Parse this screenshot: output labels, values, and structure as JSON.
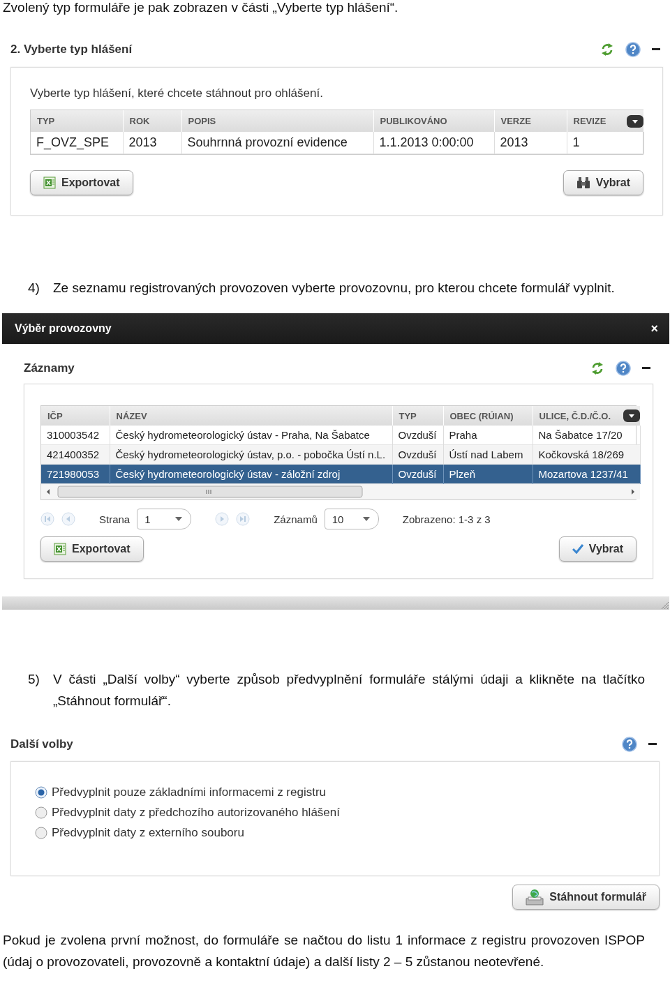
{
  "intro": "Zvolený typ formuláře je pak zobrazen v části „Vyberte typ hlášení“.",
  "report_type_panel": {
    "title": "2. Vyberte typ hlášení",
    "description": "Vyberte typ hlášení, které chcete stáhnout pro ohlášení.",
    "table": {
      "columns": [
        "TYP",
        "ROK",
        "POPIS",
        "PUBLIKOVÁNO",
        "VERZE",
        "REVIZE"
      ],
      "rows": [
        {
          "cells": [
            "F_OVZ_SPE",
            "2013",
            "Souhrnná provozní evidence",
            "1.1.2013 0:00:00",
            "2013",
            "1"
          ],
          "selected": false
        }
      ]
    },
    "buttons": [
      {
        "label": "Exportovat",
        "kind": "export"
      },
      {
        "label": "Vybrat",
        "kind": "pick"
      }
    ]
  },
  "step_4": {
    "number": "4)",
    "text": "Ze seznamu registrovaných provozoven vyberte provozovnu, pro kterou chcete formulář vyplnit."
  },
  "dialog": {
    "title": "Výběr provozovny",
    "close": "×",
    "panel": {
      "title": "Záznamy",
      "table": {
        "columns": [
          "IČP",
          "NÁZEV",
          "TYP",
          "OBEC (RÚIAN)",
          "ULICE, Č.D./Č.O."
        ],
        "rows": [
          {
            "cells": [
              "310003542",
              "Český hydrometeorologický ústav - Praha, Na Šabatce",
              "Ovzduší",
              "Praha",
              "Na Šabatce 17/20"
            ],
            "selected": false
          },
          {
            "cells": [
              "421400352",
              "Český hydrometeorologický ústav, p.o. - pobočka Ústí n.L.",
              "Ovzduší",
              "Ústí nad Labem",
              "Kočkovská 18/269"
            ],
            "selected": false
          },
          {
            "cells": [
              "721980053",
              "Český hydrometeorologický ústav - záložní zdroj",
              "Ovzduší",
              "Plzeň",
              "Mozartova 1237/41"
            ],
            "selected": true
          }
        ]
      },
      "pager": {
        "page_label": "Strana",
        "page": "1",
        "records_label": "Záznamů",
        "records": "10",
        "shown": "Zobrazeno: 1-3 z 3"
      },
      "buttons": [
        {
          "label": "Exportovat",
          "kind": "export"
        },
        {
          "label": "Vybrat",
          "kind": "confirm"
        }
      ]
    }
  },
  "step_5": {
    "number": "5)",
    "text": "V části „Další volby“ vyberte způsob předvyplnění formuláře stálými údaji a klikněte na tlačítko „Stáhnout formulář“."
  },
  "options_panel": {
    "title": "Další volby",
    "options": [
      {
        "label": "Předvyplnit pouze základními informacemi z registru",
        "selected": true
      },
      {
        "label": "Předvyplnit daty z předchozího autorizovaného hlášení",
        "selected": false
      },
      {
        "label": "Předvyplnit daty z externího souboru",
        "selected": false
      }
    ],
    "download_button": {
      "label": "Stáhnout formulář",
      "kind": "download"
    }
  },
  "outro": "Pokud je zvolena první možnost, do formuláře se načtou do listu 1 informace z registru provozoven ISPOP (údaj o provozovateli, provozovně a kontaktní údaje) a další listy 2 – 5 zůstanou neotevřené."
}
